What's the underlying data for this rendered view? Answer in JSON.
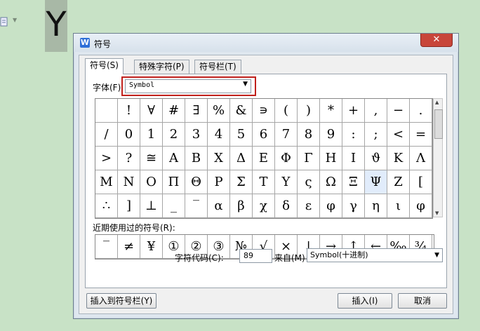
{
  "background": {
    "big_letter": "Y"
  },
  "dialog": {
    "title": "符号",
    "app_icon": "W",
    "close": "✕",
    "tabs": [
      {
        "label": "符号(S)"
      },
      {
        "label": "特殊字符(P)"
      },
      {
        "label": "符号栏(T)"
      }
    ],
    "font": {
      "label": "字体(F):",
      "value": "Symbol"
    },
    "symbols": [
      " ",
      "!",
      "∀",
      "#",
      "∃",
      "%",
      "&",
      "∍",
      "(",
      ")",
      "*",
      "+",
      ",",
      "−",
      ".",
      "/",
      "0",
      "1",
      "2",
      "3",
      "4",
      "5",
      "6",
      "7",
      "8",
      "9",
      ":",
      ";",
      "<",
      "=",
      ">",
      "?",
      "≅",
      "Α",
      "Β",
      "Χ",
      "Δ",
      "Ε",
      "Φ",
      "Γ",
      "Η",
      "Ι",
      "ϑ",
      "Κ",
      "Λ",
      "Μ",
      "Ν",
      "Ο",
      "Π",
      "Θ",
      "Ρ",
      "Σ",
      "Τ",
      "Υ",
      "ς",
      "Ω",
      "Ξ",
      "Ψ",
      "Ζ",
      "[",
      "∴",
      "]",
      "⊥",
      "_",
      "‾",
      "α",
      "β",
      "χ",
      "δ",
      "ε",
      "φ",
      "γ",
      "η",
      "ι",
      "φ"
    ],
    "selected_symbol_index": 57,
    "recent_label": "近期使用过的符号(R):",
    "recent_symbols": [
      "‾",
      "≠",
      "¥",
      "①",
      "②",
      "③",
      "№",
      "√",
      "×",
      "↓",
      "→",
      "↑",
      "←",
      "‰",
      "¾"
    ],
    "char_code_label": "字符代码(C):",
    "char_code_value": "89",
    "from_label": "来自(M)",
    "from_value": "Symbol(十进制)",
    "buttons": {
      "insert_to_bar": "插入到符号栏(Y)",
      "insert": "插入(I)",
      "cancel": "取消"
    }
  }
}
